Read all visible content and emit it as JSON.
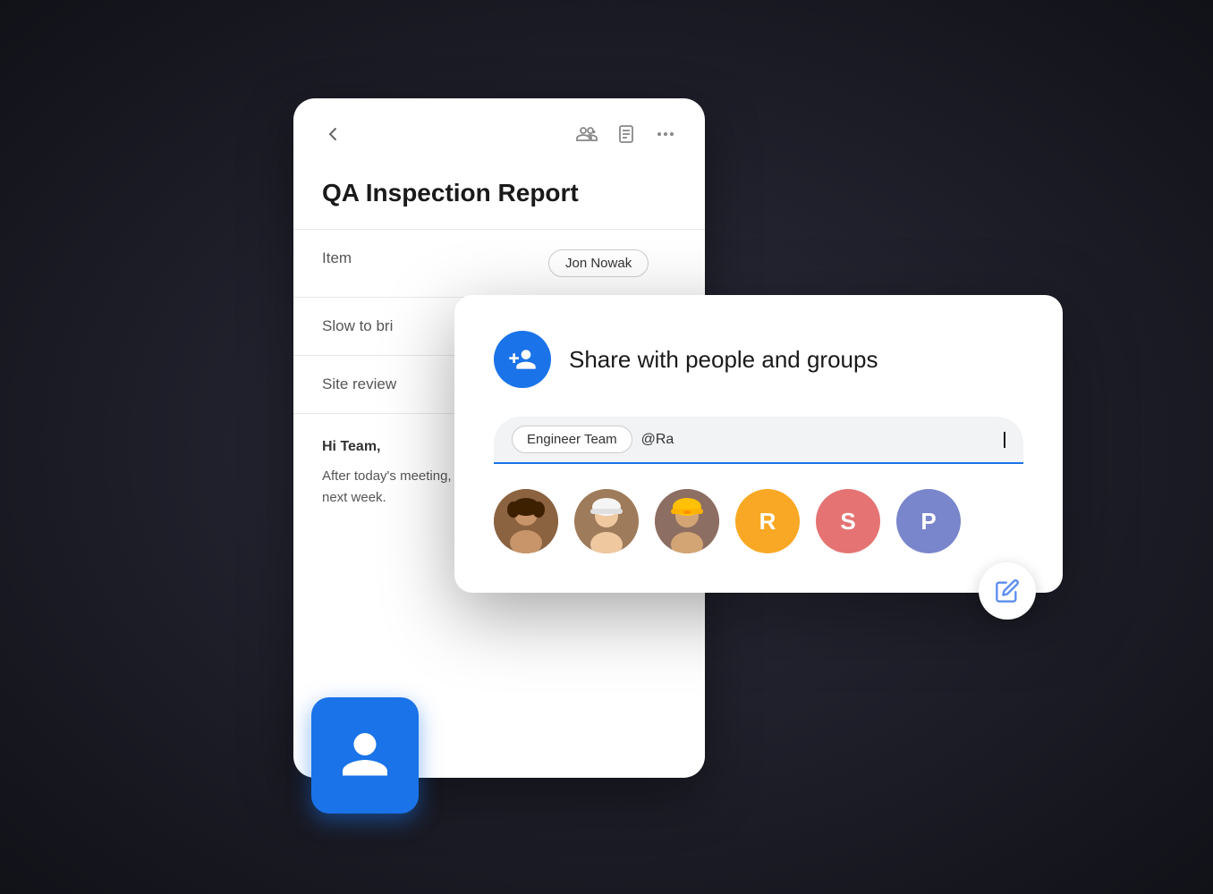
{
  "scene": {
    "doc_card": {
      "back_label": "←",
      "title": "QA Inspection Report",
      "header_icons": [
        "person-add-icon",
        "document-icon",
        "more-icon"
      ],
      "table": {
        "rows": [
          {
            "col1": "Item",
            "col2": "Jon Nowak"
          },
          {
            "col1": "Slow to bri",
            "col2": ""
          },
          {
            "col1": "Site review",
            "col2": ""
          }
        ]
      },
      "body_greeting": "Hi Team,",
      "body_text": "After today's meeting, please add your working doc before next week."
    },
    "share_dialog": {
      "title": "Share with people and groups",
      "engineer_tag": "Engineer Team",
      "input_value": "@Ra",
      "avatars": [
        {
          "type": "photo",
          "label": "person-1",
          "bg": "#6d4c41"
        },
        {
          "type": "photo",
          "label": "person-2",
          "bg": "#b0bec5"
        },
        {
          "type": "photo",
          "label": "person-3",
          "bg": "#8d6e63"
        },
        {
          "type": "letter",
          "letter": "R",
          "bg": "#f9a825"
        },
        {
          "type": "letter",
          "letter": "S",
          "bg": "#e57373"
        },
        {
          "type": "letter",
          "letter": "P",
          "bg": "#7986cb"
        }
      ]
    },
    "fab": {
      "label": "edit"
    },
    "blue_card": {
      "label": "contacts"
    }
  }
}
